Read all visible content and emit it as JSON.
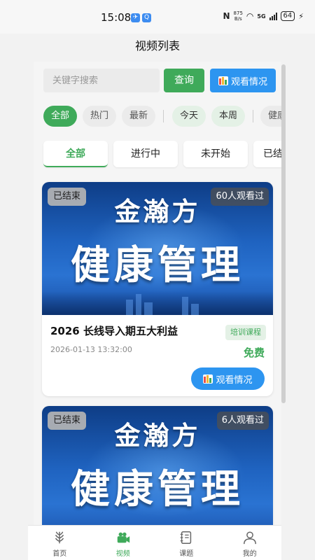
{
  "status_bar": {
    "time": "15:08",
    "net_speed_top": "875",
    "net_speed_unit": "B/s",
    "network": "5G",
    "battery": "64"
  },
  "page_title": "视频列表",
  "search": {
    "placeholder": "关键字搜索",
    "query_label": "查询",
    "watch_label": "观看情况"
  },
  "filters": {
    "chips": [
      "全部",
      "热门",
      "最新"
    ],
    "date_chips": [
      "今天",
      "本周"
    ],
    "extra_chip": "健康"
  },
  "status_tabs": [
    "全部",
    "进行中",
    "未开始",
    "已结束"
  ],
  "videos": [
    {
      "status": "已结束",
      "views": "60人观看过",
      "brand": "金瀚方",
      "headline": "健康管理",
      "title": "2026 长线导入期五大利益",
      "tag": "培训课程",
      "time": "2026-01-13 13:32:00",
      "price": "免费",
      "button": "观看情况"
    },
    {
      "status": "已结束",
      "views": "6人观看过",
      "brand": "金瀚方",
      "headline": "健康管理"
    }
  ],
  "bottom_nav": [
    {
      "label": "首页",
      "icon": "home-wheat-icon"
    },
    {
      "label": "视频",
      "icon": "video-camera-icon"
    },
    {
      "label": "课题",
      "icon": "notebook-icon"
    },
    {
      "label": "我的",
      "icon": "user-icon"
    }
  ],
  "colors": {
    "accent_green": "#3faa5a",
    "accent_blue": "#2d95f0",
    "tag_bg": "#e4f1e6"
  }
}
